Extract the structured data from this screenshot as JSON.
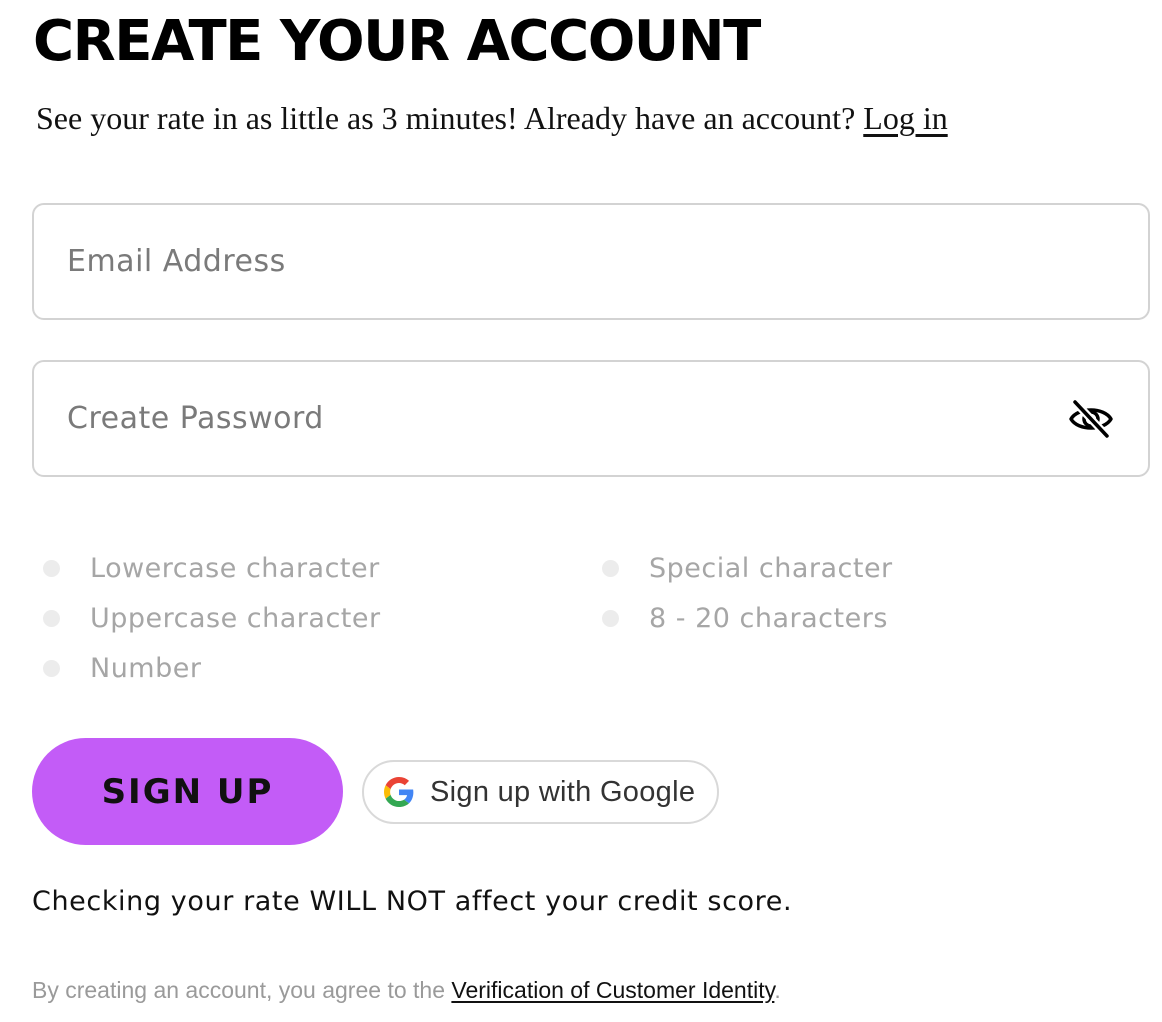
{
  "header": {
    "title": "CREATE YOUR ACCOUNT",
    "subtitle_text": "See your rate in as little as 3 minutes! Already have an account? ",
    "login_link": "Log in"
  },
  "form": {
    "email": {
      "value": "",
      "placeholder": "Email Address"
    },
    "password": {
      "value": "",
      "placeholder": "Create Password",
      "visibility_icon": "eye-off-icon"
    }
  },
  "requirements": [
    {
      "label": "Lowercase character"
    },
    {
      "label": "Uppercase character"
    },
    {
      "label": "Number"
    },
    {
      "label": "Special character"
    },
    {
      "label": "8 - 20 characters"
    }
  ],
  "buttons": {
    "signup_label": "SIGN UP",
    "google_label": "Sign up with Google",
    "google_icon": "google-icon"
  },
  "notice": "Checking your rate WILL NOT affect your credit score.",
  "legal": {
    "prefix": "By creating an account, you agree to the ",
    "link": "Verification of Customer Identity",
    "suffix": "."
  },
  "colors": {
    "accent": "#c35cf7",
    "requirement_text": "#a6a6a6",
    "requirement_dot": "#ececec"
  }
}
